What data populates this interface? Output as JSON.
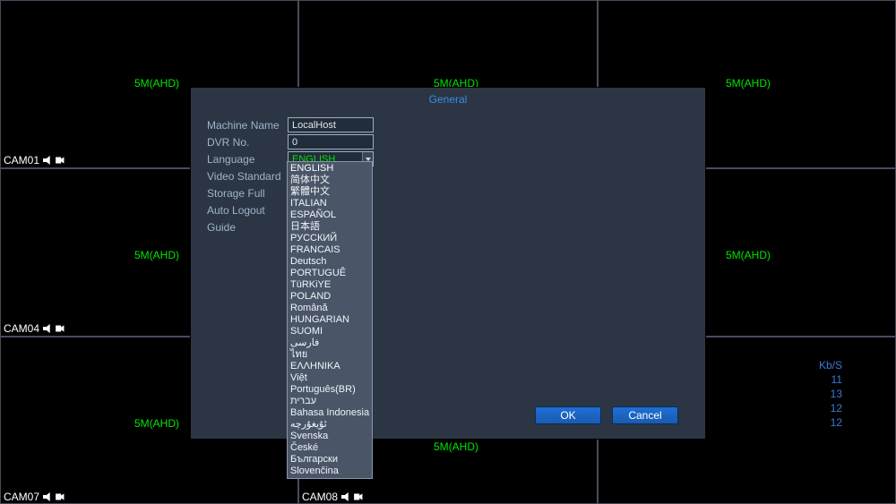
{
  "cams": {
    "c01": "CAM01",
    "c04": "CAM04",
    "c07": "CAM07",
    "c08": "CAM08"
  },
  "ahd": "5M(AHD)",
  "kbs": {
    "label": "Kb/S",
    "v1": "11",
    "v2": "13",
    "v3": "12",
    "v4": "12"
  },
  "dialog": {
    "title": "General",
    "labels": {
      "machine_name": "Machine Name",
      "dvr_no": "DVR No.",
      "language": "Language",
      "video_standard": "Video Standard",
      "storage_full": "Storage Full",
      "auto_logout": "Auto Logout",
      "guide": "Guide"
    },
    "values": {
      "machine_name": "LocalHost",
      "dvr_no": "0",
      "language": "ENGLISH"
    },
    "buttons": {
      "ok": "OK",
      "cancel": "Cancel"
    },
    "lang_options": {
      "o0": "ENGLISH",
      "o1": "简体中文",
      "o2": "繁體中文",
      "o3": "ITALIAN",
      "o4": "ESPAÑOL",
      "o5": "日本語",
      "o6": "РУССКИЙ",
      "o7": "FRANCAIS",
      "o8": "Deutsch",
      "o9": "PORTUGUÊ",
      "o10": "TüRKiYE",
      "o11": "POLAND",
      "o12": "Română",
      "o13": "HUNGARIAN",
      "o14": "SUOMI",
      "o15": "فارسی",
      "o16": "ไทย",
      "o17": "ΕΛΛΗΝΙΚΑ",
      "o18": "Việt",
      "o19": "Português(BR)",
      "o20": "עברית",
      "o21": "Bahasa Indonesia",
      "o22": "ئۇيغۇرچە",
      "o23": "Svenska",
      "o24": "České",
      "o25": "Български",
      "o26": "Slovenčina"
    }
  }
}
